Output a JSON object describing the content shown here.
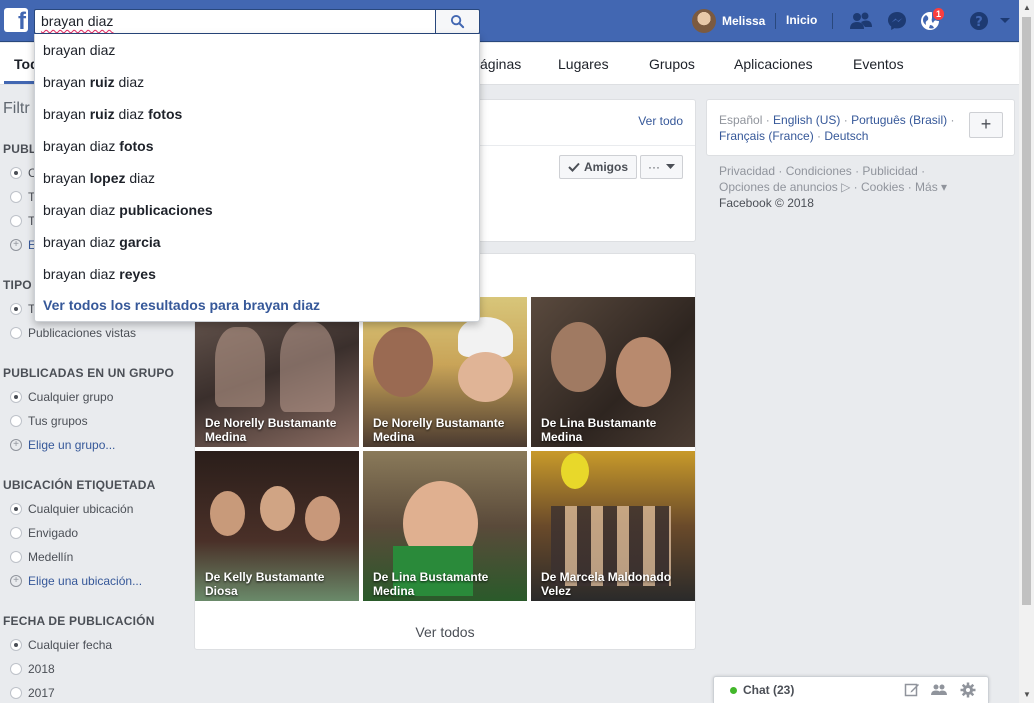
{
  "topbar": {
    "logo": "f",
    "search_value": "brayan diaz",
    "user_name": "Melissa",
    "home_label": "Inicio",
    "notification_count": "1"
  },
  "tabs": [
    "Todo",
    "Páginas",
    "Lugares",
    "Grupos",
    "Aplicaciones",
    "Eventos"
  ],
  "tabs_visible_fragments": {
    "first": "Tod",
    "pages": "áginas"
  },
  "filters": {
    "title": "Filtr",
    "sections": [
      {
        "heading": "PUBL",
        "options": [
          "C",
          "T",
          "T",
          "E"
        ]
      },
      {
        "heading": "TIPO",
        "options": [
          "T",
          "Publicaciones vistas"
        ]
      },
      {
        "heading": "PUBLICADAS EN UN GRUPO",
        "options": [
          "Cualquier grupo",
          "Tus grupos",
          "Elige un grupo..."
        ]
      },
      {
        "heading": "UBICACIÓN ETIQUETADA",
        "options": [
          "Cualquier ubicación",
          "Envigado",
          "Medellín",
          "Elige una ubicación..."
        ]
      },
      {
        "heading": "FECHA DE PUBLICACIÓN",
        "options": [
          "Cualquier fecha",
          "2018",
          "2017"
        ]
      }
    ]
  },
  "people_card": {
    "see_all": "Ver todo",
    "friends_button": "Amigos",
    "more_button": "···"
  },
  "photos_card": {
    "photos": [
      {
        "caption": "De Norelly Bustamante Medina"
      },
      {
        "caption": "De Norelly Bustamante Medina"
      },
      {
        "caption": "De Lina Bustamante Medina"
      },
      {
        "caption": "De Kelly Bustamante Diosa"
      },
      {
        "caption": "De Lina Bustamante Medina"
      },
      {
        "caption": "De Marcela Maldonado Velez"
      }
    ],
    "see_all": "Ver todos"
  },
  "languages": {
    "current": "Español",
    "others": [
      "English (US)",
      "Português (Brasil)",
      "Français (France)",
      "Deutsch"
    ],
    "add_symbol": "+"
  },
  "footer": {
    "links": [
      "Privacidad",
      "Condiciones",
      "Publicidad",
      "Opciones de anuncios",
      "Cookies",
      "Más"
    ],
    "copyright": "Facebook © 2018"
  },
  "chat": {
    "label": "Chat (23)"
  },
  "dropdown": {
    "suggestions": [
      {
        "base": "brayan diaz",
        "bold": ""
      },
      {
        "base": "brayan ",
        "bold": "ruiz",
        "tail": " diaz"
      },
      {
        "base": "brayan ",
        "bold": "ruiz",
        "tail": " diaz ",
        "bold2": "fotos"
      },
      {
        "base": "brayan diaz ",
        "bold": "fotos"
      },
      {
        "base": "brayan ",
        "bold": "lopez",
        "tail": " diaz"
      },
      {
        "base": "brayan diaz ",
        "bold": "publicaciones"
      },
      {
        "base": "brayan diaz ",
        "bold": "garcia"
      },
      {
        "base": "brayan diaz ",
        "bold": "reyes"
      }
    ],
    "see_all_results": "Ver todos los resultados para brayan diaz"
  },
  "colors": {
    "brand": "#4267b2",
    "link": "#365899",
    "online": "#42b72a",
    "badge": "#fa3e3e"
  }
}
